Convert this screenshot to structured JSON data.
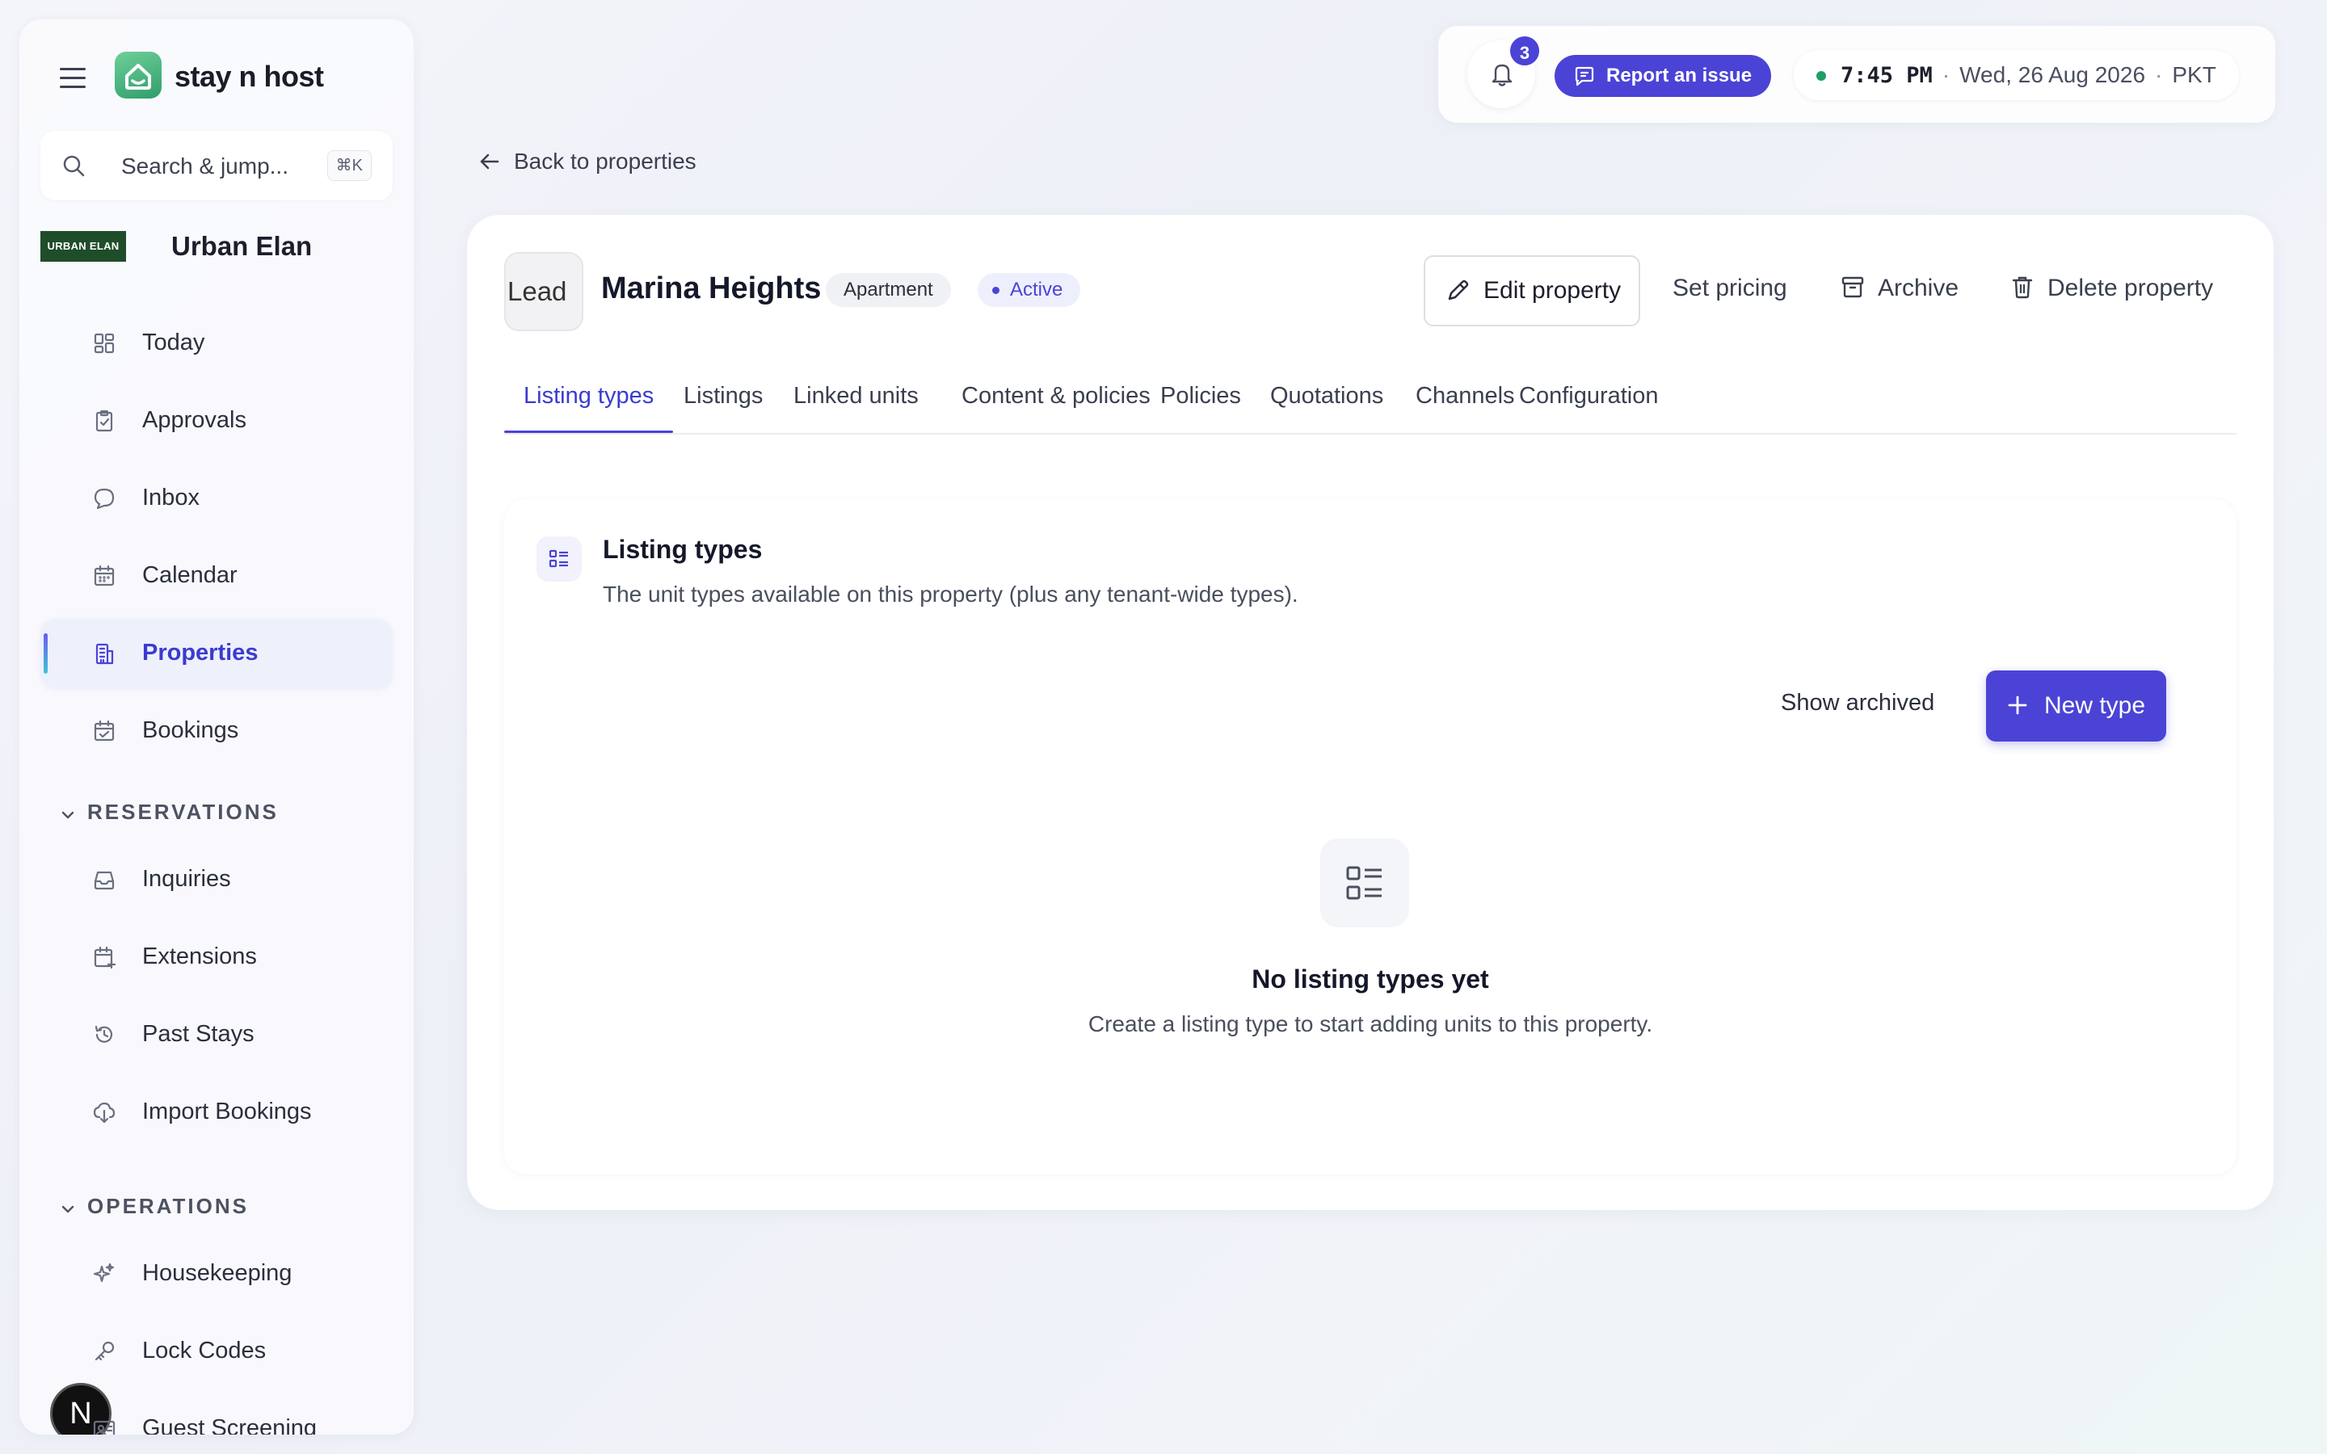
{
  "app": {
    "name": "stay n host"
  },
  "search": {
    "placeholder": "Search & jump...",
    "shortcut": "⌘K"
  },
  "org": {
    "logo_text": "URBAN ELAN",
    "name": "Urban Elan"
  },
  "sidebar": {
    "items": [
      {
        "label": "Today",
        "icon": "dashboard-icon"
      },
      {
        "label": "Approvals",
        "icon": "clipboard-check-icon"
      },
      {
        "label": "Inbox",
        "icon": "chat-bubble-icon"
      },
      {
        "label": "Calendar",
        "icon": "calendar-icon"
      },
      {
        "label": "Properties",
        "icon": "building-icon",
        "active": true
      },
      {
        "label": "Bookings",
        "icon": "calendar-check-icon"
      }
    ],
    "sections": [
      {
        "title": "RESERVATIONS",
        "items": [
          {
            "label": "Inquiries",
            "icon": "inbox-tray-icon"
          },
          {
            "label": "Extensions",
            "icon": "calendar-plus-icon"
          },
          {
            "label": "Past Stays",
            "icon": "history-icon"
          },
          {
            "label": "Import Bookings",
            "icon": "cloud-download-icon"
          }
        ]
      },
      {
        "title": "OPERATIONS",
        "items": [
          {
            "label": "Housekeeping",
            "icon": "sparkles-icon"
          },
          {
            "label": "Lock Codes",
            "icon": "key-icon"
          },
          {
            "label": "Guest Screening",
            "icon": "id-card-icon"
          }
        ]
      }
    ]
  },
  "user_avatar": "N",
  "topbar": {
    "notification_count": "3",
    "report_label": "Report an issue",
    "time": "7:45 PM",
    "date": "Wed, 26 Aug 2026",
    "timezone": "PKT"
  },
  "back_label": "Back to properties",
  "property": {
    "thumb_alt": "Lead",
    "name": "Marina Heights",
    "type": "Apartment",
    "status": "Active",
    "actions": {
      "edit": "Edit property",
      "pricing": "Set pricing",
      "archive": "Archive",
      "delete": "Delete property"
    }
  },
  "tabs": [
    {
      "label": "Listing types",
      "active": true
    },
    {
      "label": "Listings"
    },
    {
      "label": "Linked units"
    },
    {
      "label": "Content & policies"
    },
    {
      "label": "Policies"
    },
    {
      "label": "Quotations"
    },
    {
      "label": "Channels"
    },
    {
      "label": "Configuration"
    }
  ],
  "panel": {
    "title": "Listing types",
    "subtitle": "The unit types available on this property (plus any tenant-wide types).",
    "show_archived": "Show archived",
    "new_button": "New type",
    "empty_title": "No listing types yet",
    "empty_subtitle": "Create a listing type to start adding units to this property."
  },
  "colors": {
    "accent": "#4b43d6",
    "brand_green": "#2f9e6a",
    "status_dot": "#1f9e6a"
  }
}
